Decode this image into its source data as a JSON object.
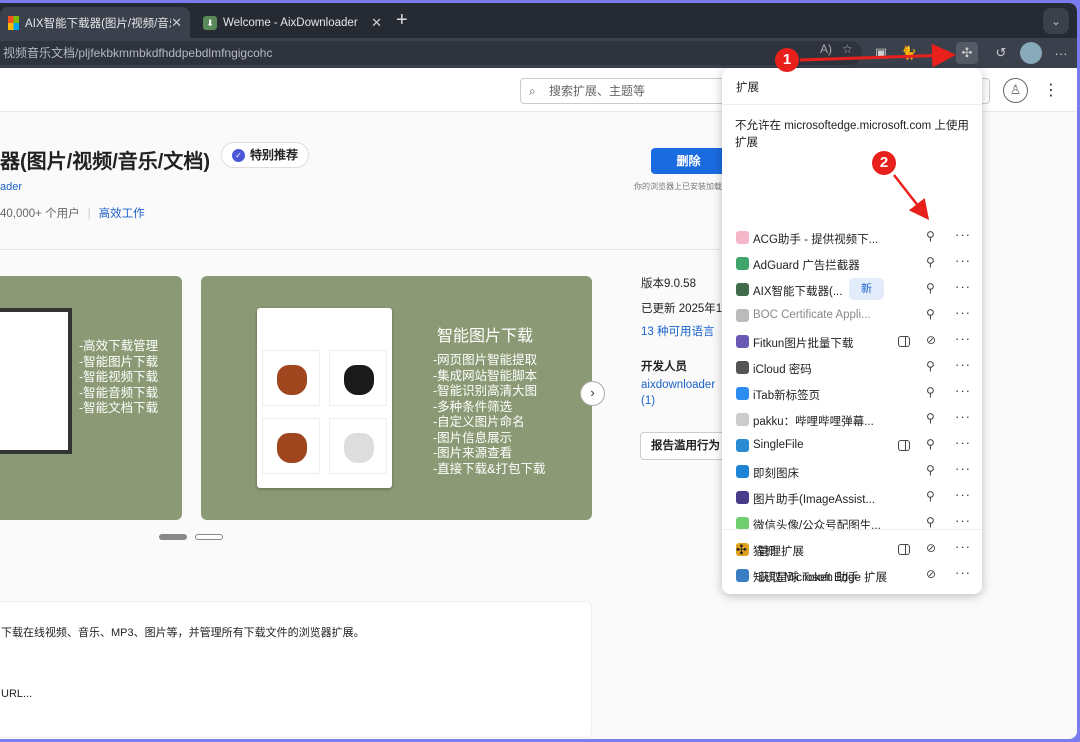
{
  "browser": {
    "tabs": [
      {
        "label": "AIX智能下载器(图片/视频/音乐/文档)"
      },
      {
        "label": "Welcome - AixDownloader"
      }
    ],
    "url": "视频音乐文档/pljfekbkmmbkdfhddpebdlmfngigcohc"
  },
  "store": {
    "search_placeholder": "搜索扩展、主题等",
    "title": "器(图片/视频/音乐/文档)",
    "badge": "特别推荐",
    "developer_link": "ader",
    "users": "40,000+ 个用户",
    "category": "高效工作",
    "remove_label": "删除",
    "install_note": "你的浏览器上已安装加载项",
    "carousel": {
      "left_features": "-高效下载管理\n-智能图片下载\n-智能视频下载\n-智能音频下载\n-智能文档下载",
      "right_title": "智能图片下载",
      "right_features": "-网页图片智能提取\n-集成网站智能脚本\n-智能识别高清大图\n-多种条件筛选\n-自定义图片命名\n-图片信息展示\n-图片来源查看\n-直接下载&打包下载"
    },
    "version": "版本9.0.58",
    "updated": "已更新 2025年1",
    "languages": "13 种可用语言",
    "developer_heading": "开发人员",
    "developer_name": "aixdownloader",
    "developer_count": "(1)",
    "report_label": "报告滥用行为",
    "desc_line1": "下载在线视频、音乐、MP3、图片等，并管理所有下载文件的浏览器扩展。",
    "desc_line2": "URL..."
  },
  "extensions_popup": {
    "title": "扩展",
    "warning": "不允许在 microsoftedge.microsoft.com 上使用扩展",
    "items": [
      {
        "name": "ACG助手 - 提供视频下...",
        "color": "#f4b6c8",
        "pinned": true
      },
      {
        "name": "AdGuard 广告拦截器",
        "color": "#3fa56b",
        "pinned": true
      },
      {
        "name": "AIX智能下载器(...",
        "color": "#3f6b4a",
        "pinned": true,
        "badge": "新"
      },
      {
        "name": "BOC Certificate Appli...",
        "color": "#bbbbbb",
        "pinned": true,
        "disabled": true
      },
      {
        "name": "Fitkun图片批量下载",
        "color": "#6b5ab5",
        "pinned": false,
        "sidebar": true
      },
      {
        "name": "iCloud 密码",
        "color": "#555555",
        "pinned": true
      },
      {
        "name": "iTab新标签页",
        "color": "#2d8cf0",
        "pinned": true
      },
      {
        "name": "pakku：哔哩哔哩弹幕...",
        "color": "#cccccc",
        "pinned": true
      },
      {
        "name": "SingleFile",
        "color": "#2a8ad4",
        "pinned": true,
        "sidebar": true
      },
      {
        "name": "即刻图床",
        "color": "#1d84d6",
        "pinned": true
      },
      {
        "name": "图片助手(ImageAssist...",
        "color": "#4a3a8a",
        "pinned": true
      },
      {
        "name": "微信头像/公众号配图生...",
        "color": "#6fcf6f",
        "pinned": true
      },
      {
        "name": "猫抓",
        "color": "#e0a020",
        "pinned": false,
        "sidebar": true
      },
      {
        "name": "知识星球 Token 助手",
        "color": "#3a7fc4",
        "pinned": false
      }
    ],
    "manage": "管理扩展",
    "get_more": "获取 Microsoft Edge 扩展"
  },
  "annotations": [
    "1",
    "2"
  ],
  "colors": {
    "accent": "#1a6ae0",
    "annotation": "#e8201c",
    "card": "#8b9a74"
  }
}
